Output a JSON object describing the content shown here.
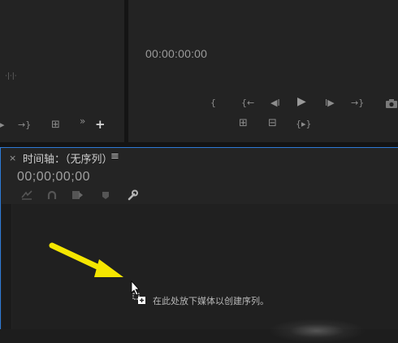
{
  "program_monitor": {
    "timecode": "00:00:00:00",
    "controls": {
      "mark_in": "{",
      "step_prev_mark": "{←",
      "step_back": "◀I",
      "play": "▶",
      "step_forward": "I▶",
      "go_next_mark": "→}",
      "lift": "⊞",
      "extract": "⊟",
      "trim": "{▸}"
    }
  },
  "source_monitor": {
    "controls": {
      "ticks": "·|·|·",
      "go_out": "→}",
      "overwrite": "⊞",
      "more": "»",
      "add": "+"
    }
  },
  "timeline": {
    "close": "×",
    "title": "时间轴：（无序列）",
    "menu": "≡",
    "timecode": "00;00;00;00",
    "drop_hint": "在此处放下媒体以创建序列。"
  },
  "colors": {
    "focus_border": "#2d7ad6",
    "arrow": "#f5e600",
    "background": "#232323"
  }
}
